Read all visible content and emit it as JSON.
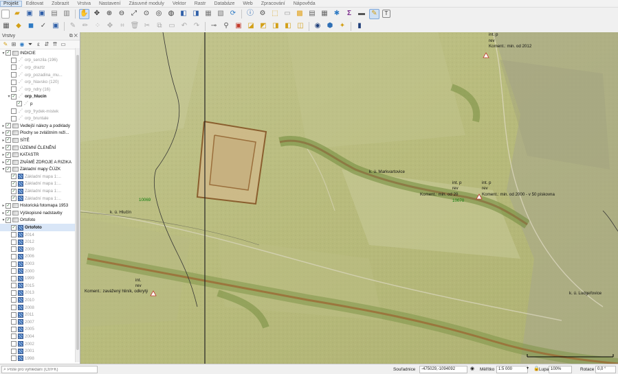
{
  "menubar": {
    "items": [
      "Projekt",
      "Editovat",
      "Zobrazit",
      "Vrstva",
      "Nastavení",
      "Zásuvné moduly",
      "Vektor",
      "Rastr",
      "Databáze",
      "Web",
      "Zpracování",
      "Nápověda"
    ]
  },
  "panel": {
    "title": "Vrstvy",
    "layers": [
      {
        "label": "INDICIE",
        "exp": "▾",
        "checked": true,
        "icon": "group",
        "indent": 0,
        "style": "normal"
      },
      {
        "label": "orp_senzila (196)",
        "exp": "",
        "checked": false,
        "icon": "point",
        "indent": 1,
        "style": "muted"
      },
      {
        "label": "orp_draztz",
        "exp": "",
        "checked": false,
        "icon": "point",
        "indent": 1,
        "style": "muted"
      },
      {
        "label": "orp_pozadina_mu...",
        "exp": "",
        "checked": false,
        "icon": "point",
        "indent": 1,
        "style": "muted"
      },
      {
        "label": "orp_hlavsko (120)",
        "exp": "",
        "checked": false,
        "icon": "point",
        "indent": 1,
        "style": "muted"
      },
      {
        "label": "orp_ndry (16)",
        "exp": "",
        "checked": false,
        "icon": "point",
        "indent": 1,
        "style": "muted"
      },
      {
        "label": "orp_hlucin",
        "exp": "▾",
        "checked": true,
        "icon": "point",
        "indent": 1,
        "style": "bold"
      },
      {
        "label": "p",
        "exp": "",
        "checked": true,
        "icon": "point",
        "indent": 2,
        "style": "normal"
      },
      {
        "label": "orp_frydek-mistek",
        "exp": "",
        "checked": false,
        "icon": "point",
        "indent": 1,
        "style": "muted"
      },
      {
        "label": "orp_bruntale",
        "exp": "",
        "checked": false,
        "icon": "point",
        "indent": 1,
        "style": "muted"
      },
      {
        "label": "Vedlejší nálezy a podklady",
        "exp": "▸",
        "checked": true,
        "icon": "group",
        "indent": 0,
        "style": "normal"
      },
      {
        "label": "Plochy se zvláštním reži...",
        "exp": "▸",
        "checked": true,
        "icon": "group",
        "indent": 0,
        "style": "normal"
      },
      {
        "label": "SÍTĚ",
        "exp": "▸",
        "checked": true,
        "icon": "group",
        "indent": 0,
        "style": "normal"
      },
      {
        "label": "ÚZEMNÍ ČLENĚNÍ",
        "exp": "▸",
        "checked": true,
        "icon": "group",
        "indent": 0,
        "style": "normal"
      },
      {
        "label": "KATASTR",
        "exp": "▸",
        "checked": true,
        "icon": "group",
        "indent": 0,
        "style": "normal"
      },
      {
        "label": "ZNÁMÉ ZDROJE A RIZIKA",
        "exp": "▸",
        "checked": true,
        "icon": "group",
        "indent": 0,
        "style": "normal"
      },
      {
        "label": "Základní mapy ČÚZK",
        "exp": "▾",
        "checked": true,
        "icon": "group",
        "indent": 0,
        "style": "normal"
      },
      {
        "label": "Základní mapa 1:...",
        "exp": "",
        "checked": true,
        "icon": "raster",
        "indent": 1,
        "style": "muted"
      },
      {
        "label": "Základní mapa 1:...",
        "exp": "",
        "checked": true,
        "icon": "raster",
        "indent": 1,
        "style": "muted"
      },
      {
        "label": "Základní mapa 1:...",
        "exp": "",
        "checked": true,
        "icon": "raster",
        "indent": 1,
        "style": "muted"
      },
      {
        "label": "Základní mapa 1:...",
        "exp": "",
        "checked": true,
        "icon": "raster",
        "indent": 1,
        "style": "muted"
      },
      {
        "label": "Historická fotomapa 1953",
        "exp": "▸",
        "checked": true,
        "icon": "group",
        "indent": 0,
        "style": "normal"
      },
      {
        "label": "Výškopisné nadstavby",
        "exp": "▸",
        "checked": true,
        "icon": "group",
        "indent": 0,
        "style": "normal"
      },
      {
        "label": "Ortofoto",
        "exp": "▾",
        "checked": true,
        "icon": "group",
        "indent": 0,
        "style": "normal"
      },
      {
        "label": "Ortofoto",
        "exp": "",
        "checked": true,
        "icon": "raster",
        "indent": 1,
        "style": "boldsel"
      },
      {
        "label": "2014",
        "exp": "",
        "checked": false,
        "icon": "raster",
        "indent": 1,
        "style": "muted"
      },
      {
        "label": "2012",
        "exp": "",
        "checked": false,
        "icon": "raster",
        "indent": 1,
        "style": "muted"
      },
      {
        "label": "2009",
        "exp": "",
        "checked": false,
        "icon": "raster",
        "indent": 1,
        "style": "muted"
      },
      {
        "label": "2006",
        "exp": "",
        "checked": false,
        "icon": "raster",
        "indent": 1,
        "style": "muted"
      },
      {
        "label": "2003",
        "exp": "",
        "checked": false,
        "icon": "raster",
        "indent": 1,
        "style": "muted"
      },
      {
        "label": "2000",
        "exp": "",
        "checked": false,
        "icon": "raster",
        "indent": 1,
        "style": "muted"
      },
      {
        "label": "1999",
        "exp": "",
        "checked": false,
        "icon": "raster",
        "indent": 1,
        "style": "muted"
      },
      {
        "label": "2015",
        "exp": "",
        "checked": false,
        "icon": "raster",
        "indent": 1,
        "style": "muted"
      },
      {
        "label": "2013",
        "exp": "",
        "checked": false,
        "icon": "raster",
        "indent": 1,
        "style": "muted"
      },
      {
        "label": "2010",
        "exp": "",
        "checked": false,
        "icon": "raster",
        "indent": 1,
        "style": "muted"
      },
      {
        "label": "2008",
        "exp": "",
        "checked": false,
        "icon": "raster",
        "indent": 1,
        "style": "muted"
      },
      {
        "label": "2011",
        "exp": "",
        "checked": false,
        "icon": "raster",
        "indent": 1,
        "style": "muted"
      },
      {
        "label": "2007",
        "exp": "",
        "checked": false,
        "icon": "raster",
        "indent": 1,
        "style": "muted"
      },
      {
        "label": "2005",
        "exp": "",
        "checked": false,
        "icon": "raster",
        "indent": 1,
        "style": "muted"
      },
      {
        "label": "2004",
        "exp": "",
        "checked": false,
        "icon": "raster",
        "indent": 1,
        "style": "muted"
      },
      {
        "label": "2002",
        "exp": "",
        "checked": false,
        "icon": "raster",
        "indent": 1,
        "style": "muted"
      },
      {
        "label": "2001",
        "exp": "",
        "checked": false,
        "icon": "raster",
        "indent": 1,
        "style": "muted"
      },
      {
        "label": "1998",
        "exp": "",
        "checked": false,
        "icon": "raster",
        "indent": 1,
        "style": "muted"
      }
    ]
  },
  "map": {
    "labels": {
      "int_1": "int.    p",
      "rev_1": "rev",
      "koment_1": "Koment.: min. od 2012",
      "ku_markvartovice": "k. ú. Markvartovice",
      "int_2": "int.    p",
      "rev_2": "rev",
      "koment_2": "Koment.: min. od 20",
      "int_3": "int.    p",
      "rev_3": "rev",
      "koment_3": "Koment.: min. od 2000 - v 50 pískovna",
      "code_10070": "10070",
      "code_10069": "10069",
      "ku_hlucin": "k. ú. Hlučín",
      "int_4": "int.",
      "rev_4": "rev",
      "koment_4": "Koment.: zavážený hliník, odkrytý",
      "ku_ludgerovice": "k. ú. Ludgeřovice"
    }
  },
  "statusbar": {
    "search_placeholder": "Pište pro vyhledání (Ctrl+K)",
    "coord_label": "Souřadnice",
    "coord_value": "-475029,-1094092",
    "scale_label": "Měřítko",
    "scale_value": "1:5 000",
    "magnifier_label": "Lupa",
    "magnifier_value": "100%",
    "rotation_label": "Rotace",
    "rotation_value": "0,0 °"
  }
}
